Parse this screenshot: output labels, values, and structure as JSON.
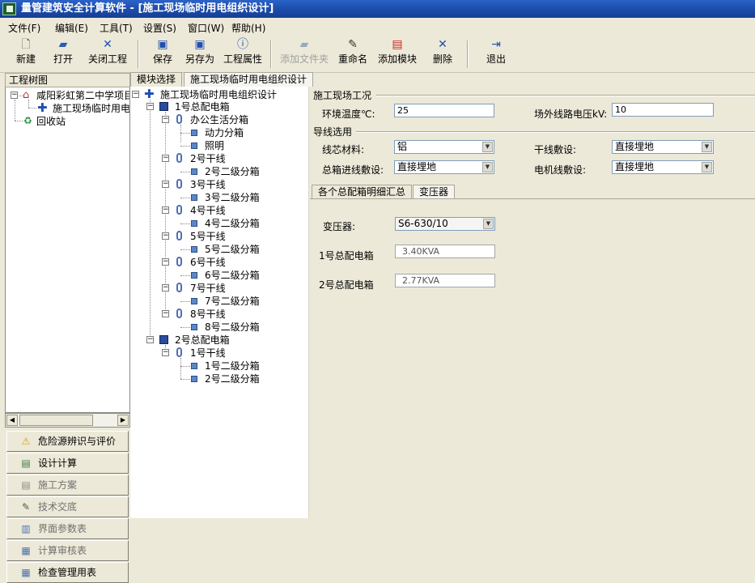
{
  "window": {
    "title": "量管建筑安全计算软件 - [施工现场临时用电组织设计]"
  },
  "menu": [
    "文件(F)",
    "编辑(E)",
    "工具(T)",
    "设置(S)",
    "窗口(W)",
    "帮助(H)"
  ],
  "toolbar": {
    "new": "新建",
    "open": "打开",
    "close_project": "关闭工程",
    "save": "保存",
    "save_as": "另存为",
    "project_props": "工程属性",
    "add_folder": "添加文件夹",
    "rename": "重命名",
    "add_module": "添加模块",
    "delete": "删除",
    "exit": "退出"
  },
  "left_panel": {
    "header": "工程树图",
    "tree": {
      "project": "咸阳彩虹第二中学项目",
      "child": "施工现场临时用电",
      "recycle": "回收站"
    },
    "nav": [
      "危险源辨识与评价",
      "设计计算",
      "施工方案",
      "技术交底",
      "界面参数表",
      "计算审核表",
      "检查管理用表"
    ]
  },
  "tabs": {
    "module_select": "模块选择",
    "design": "施工现场临时用电组织设计"
  },
  "mid_tree": {
    "root": "施工现场临时用电组织设计",
    "dist1": "1号总配电箱",
    "office": "办公生活分箱",
    "power": "动力分箱",
    "lighting": "照明",
    "lines": [
      {
        "trunk": "2号干线",
        "sub": "2号二级分箱"
      },
      {
        "trunk": "3号干线",
        "sub": "3号二级分箱"
      },
      {
        "trunk": "4号干线",
        "sub": "4号二级分箱"
      },
      {
        "trunk": "5号干线",
        "sub": "5号二级分箱"
      },
      {
        "trunk": "6号干线",
        "sub": "6号二级分箱"
      },
      {
        "trunk": "7号干线",
        "sub": "7号二级分箱"
      },
      {
        "trunk": "8号干线",
        "sub": "8号二级分箱"
      }
    ],
    "dist2": "2号总配电箱",
    "d2_trunk": "1号干线",
    "d2_sub1": "1号二级分箱",
    "d2_sub2": "2号二级分箱"
  },
  "right": {
    "site_group": "施工现场工况",
    "env_temp_label": "环境温度℃:",
    "env_temp_value": "25",
    "voltage_label": "场外线路电压kV:",
    "voltage_value": "10",
    "wire_group": "导线选用",
    "core_label": "线芯材料:",
    "core_value": "铝",
    "trunk_laying_label": "干线敷设:",
    "trunk_laying_value": "直接埋地",
    "box_laying_label": "总箱进线敷设:",
    "box_laying_value": "直接埋地",
    "motor_laying_label": "电机线敷设:",
    "motor_laying_value": "直接埋地",
    "tab_summary": "各个总配箱明细汇总",
    "tab_transformer": "变压器",
    "transformer_label": "变压器:",
    "transformer_value": "S6-630/10",
    "box1_label": "1号总配电箱",
    "box1_value": "3.40KVA",
    "box2_label": "2号总配电箱",
    "box2_value": "2.77KVA"
  }
}
